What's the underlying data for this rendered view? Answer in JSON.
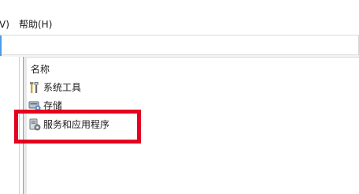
{
  "menubar": {
    "items": [
      {
        "label": "V)"
      },
      {
        "label": "帮助(H)"
      }
    ]
  },
  "list": {
    "column_header": "名称",
    "items": [
      {
        "label": "系统工具",
        "icon": "system-tools-icon"
      },
      {
        "label": "存储",
        "icon": "storage-icon"
      },
      {
        "label": "服务和应用程序",
        "icon": "services-apps-icon"
      }
    ]
  },
  "colors": {
    "highlight": "#e5001f",
    "accent": "#4b9be5"
  }
}
